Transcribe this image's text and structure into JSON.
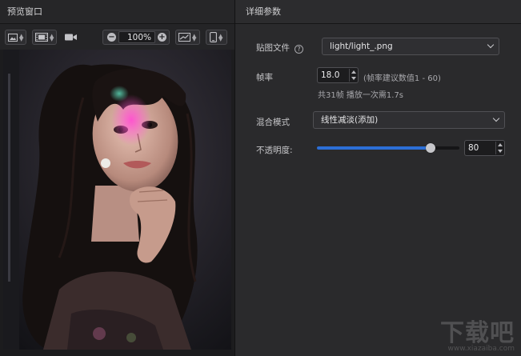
{
  "left_panel": {
    "title": "预览窗口",
    "toolbar": {
      "zoom_value": "100%",
      "icons": [
        "image-icon",
        "filmstrip-icon",
        "camera-icon",
        "zoom-out-icon",
        "zoom-in-icon",
        "chart-icon",
        "phone-icon"
      ]
    }
  },
  "right_panel": {
    "title": "详细参数",
    "texture_file": {
      "label": "贴图文件",
      "help": "?",
      "value": "light/light_.png"
    },
    "frame_rate": {
      "label": "帧率",
      "value": "18.0",
      "suggestion": "(帧率建议数值1 - 60)",
      "summary": "共31帧 播放一次需1.7s"
    },
    "blend_mode": {
      "label": "混合模式",
      "value": "线性减淡(添加)"
    },
    "opacity": {
      "label": "不透明度:",
      "value": "80",
      "level_percent": 80
    }
  },
  "watermark": {
    "text": "下载吧",
    "sub": "www.xiazaiba.com"
  },
  "colors": {
    "accent": "#2c6fd6",
    "panel_bg": "#2a2a2c",
    "preview_bg": "#1c1c1e"
  }
}
